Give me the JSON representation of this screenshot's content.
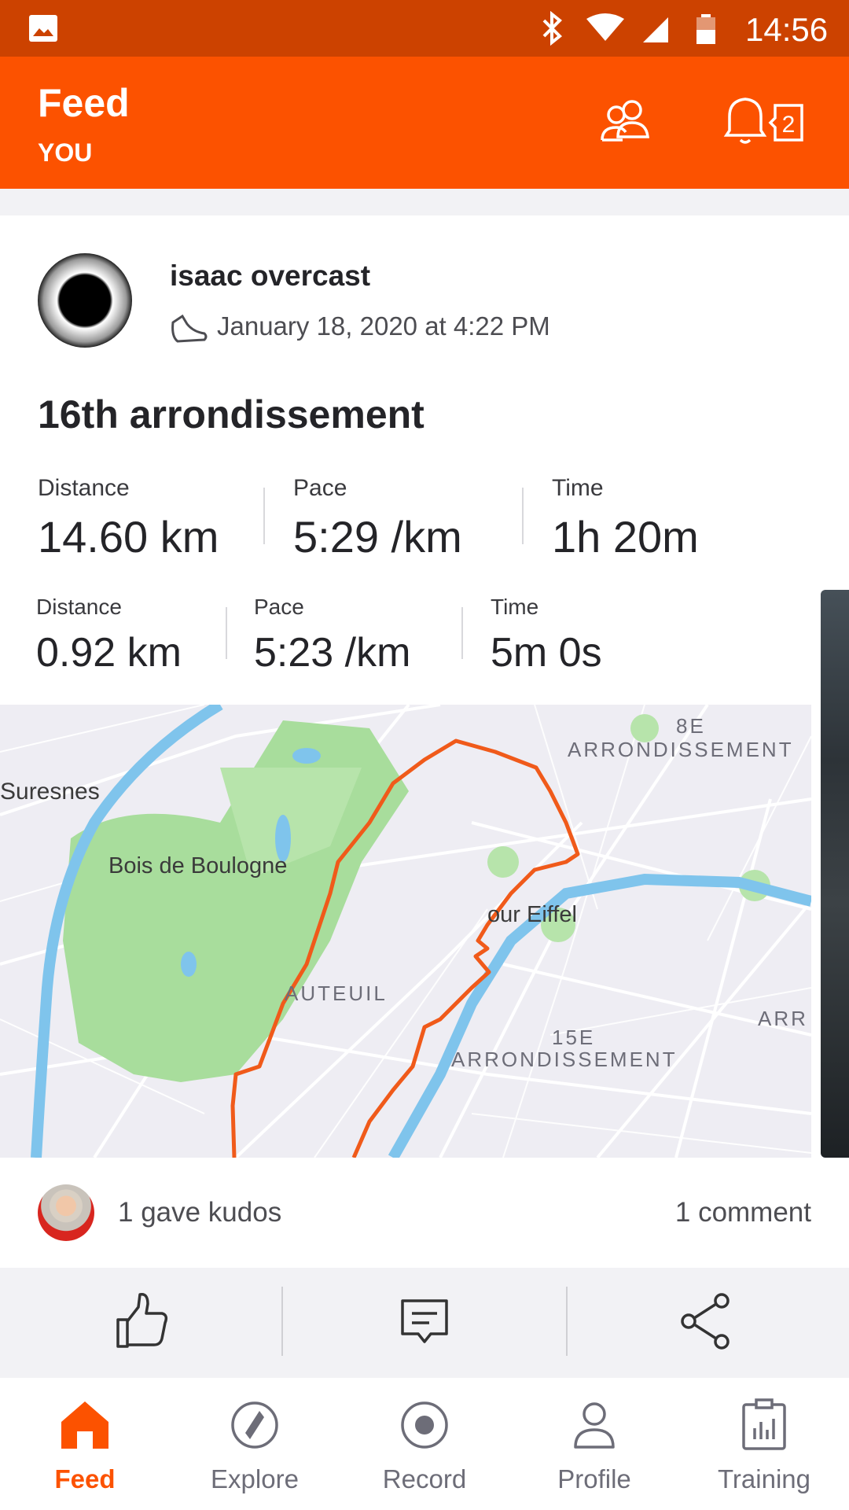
{
  "status_bar": {
    "time": "14:56",
    "icons": [
      "image-icon",
      "bluetooth-icon",
      "wifi-icon",
      "signal-icon",
      "battery-icon"
    ]
  },
  "header": {
    "title": "Feed",
    "subtitle": "YOU",
    "notification_count": "2"
  },
  "activity": {
    "athlete": "isaac overcast",
    "datetime": "January 18, 2020 at 4:22 PM",
    "title": "16th arrondissement",
    "stats": [
      {
        "label": "Distance",
        "value": "14.60 km"
      },
      {
        "label": "Pace",
        "value": "5:29 /km"
      },
      {
        "label": "Time",
        "value": "1h 20m"
      }
    ],
    "split_stats": [
      {
        "label": "Distance",
        "value": "0.92 km"
      },
      {
        "label": "Pace",
        "value": "5:23 /km"
      },
      {
        "label": "Time",
        "value": "5m 0s"
      }
    ],
    "map_labels": {
      "suresnes": "Suresnes",
      "bois": "Bois de Boulogne",
      "eiffel": "our Eiffel",
      "arr8_a": "8E",
      "arr8_b": "ARRONDISSEMENT",
      "auteuil": "AUTEUIL",
      "arr": "ARR",
      "arr15_a": "15E",
      "arr15_b": "ARRONDISSEMENT"
    },
    "kudos_text": "1 gave kudos",
    "comments_text": "1 comment"
  },
  "actions": [
    "thumbs-up-icon",
    "comment-icon",
    "share-icon"
  ],
  "nav": [
    {
      "label": "Feed",
      "icon": "home-icon",
      "active": true
    },
    {
      "label": "Explore",
      "icon": "compass-icon",
      "active": false
    },
    {
      "label": "Record",
      "icon": "record-icon",
      "active": false
    },
    {
      "label": "Profile",
      "icon": "profile-icon",
      "active": false
    },
    {
      "label": "Training",
      "icon": "training-icon",
      "active": false
    }
  ],
  "colors": {
    "brand": "#fc5200",
    "status_bar": "#cc4200",
    "route": "#f05a1a",
    "park": "#a8dd9c",
    "water": "#7fc4ec"
  }
}
